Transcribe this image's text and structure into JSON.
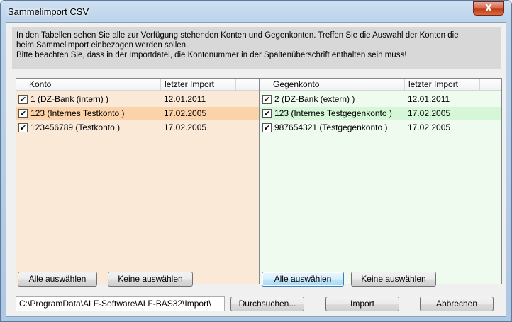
{
  "window": {
    "title": "Sammelimport  CSV",
    "close_label": "X"
  },
  "info": {
    "line1": "In den Tabellen sehen Sie alle zur Verfügung stehenden Konten und Gegenkonten. Treffen Sie die Auswahl der Konten die",
    "line2": "beim Sammelimport einbezogen werden sollen.",
    "line3": "Bitte beachten Sie, dass in der Importdatei, die Kontonummer in der Spaltenüberschrift enthalten sein muss!"
  },
  "konten": {
    "columns": [
      "Konto",
      "letzter Import"
    ],
    "rows": [
      {
        "checked": "✔",
        "name": "1 (DZ-Bank (intern) )",
        "date": "12.01.2011"
      },
      {
        "checked": "✔",
        "name": "123 (Internes Testkonto )",
        "date": "17.02.2005"
      },
      {
        "checked": "✔",
        "name": "123456789 (Testkonto )",
        "date": "17.02.2005"
      }
    ]
  },
  "gegenkonten": {
    "columns": [
      "Gegenkonto",
      "letzter Import"
    ],
    "rows": [
      {
        "checked": "✔",
        "name": "2 (DZ-Bank (extern) )",
        "date": "12.01.2011"
      },
      {
        "checked": "✔",
        "name": "123 (Internes Testgegenkonto )",
        "date": "17.02.2005"
      },
      {
        "checked": "✔",
        "name": "987654321 (Testgegenkonto )",
        "date": "17.02.2005"
      }
    ]
  },
  "buttons": {
    "select_all": "Alle auswählen",
    "select_none": "Keine auswählen",
    "browse": "Durchsuchen...",
    "import": "Import",
    "cancel": "Abbrechen"
  },
  "path": {
    "value": "C:\\ProgramData\\ALF-Software\\ALF-BAS32\\Import\\"
  }
}
